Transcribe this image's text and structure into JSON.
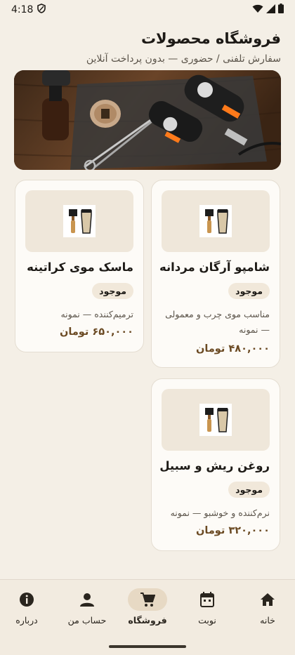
{
  "status": {
    "time": "4:18"
  },
  "header": {
    "title": "فروشگاه محصولات",
    "subtitle": "سفارش تلفنی / حضوری — بدون پرداخت آنلاین"
  },
  "products": [
    {
      "name": "شامپو آرگان مردانه",
      "badge": "موجود",
      "description": "مناسب موی چرب و معمولی — نمونه",
      "price": "۴۸۰,۰۰۰ تومان"
    },
    {
      "name": "ماسک موی کراتینه",
      "badge": "موجود",
      "description": "ترمیم‌کننده — نمونه",
      "price": "۶۵۰,۰۰۰ تومان"
    },
    {
      "name": "روغن ریش و سبیل",
      "badge": "موجود",
      "description": "نرم‌کننده و خوشبو — نمونه",
      "price": "۳۲۰,۰۰۰ تومان"
    }
  ],
  "nav": {
    "home": "خانه",
    "appointment": "نوبت",
    "shop": "فروشگاه",
    "account": "حساب من",
    "about": "درباره"
  },
  "colors": {
    "background": "#f4efe6",
    "accent": "#6b4a23",
    "active_nav": "#e7d9c4"
  }
}
